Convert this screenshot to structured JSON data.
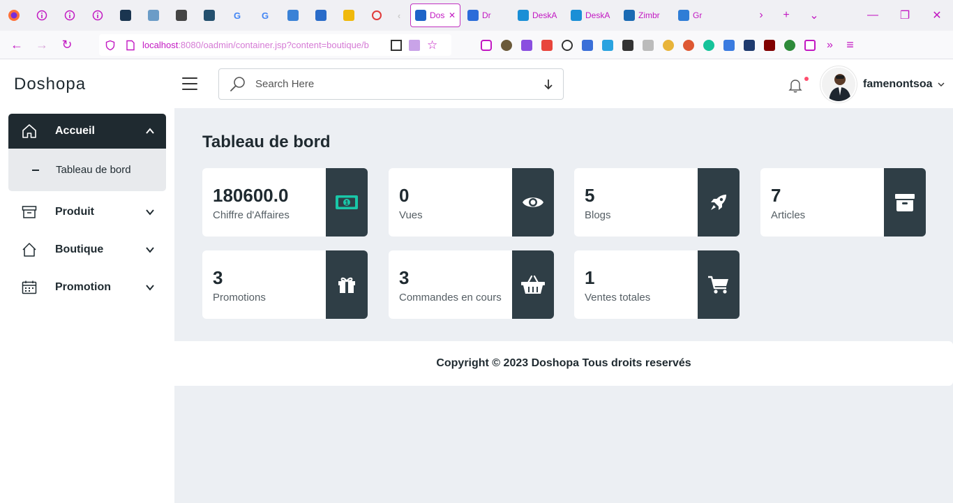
{
  "browser": {
    "active_tab_label": "Doshopa",
    "named_tabs": [
      {
        "label": "Dr",
        "color": "#2b6cd9"
      },
      {
        "label": "DeskA",
        "color": "#1a8fd6"
      },
      {
        "label": "DeskA",
        "color": "#1a8fd6"
      },
      {
        "label": "Zimbr",
        "color": "#1a6ab3"
      },
      {
        "label": "Gr",
        "color": "#2f7dd6"
      }
    ],
    "url_host": "localhost",
    "url_rest": ":8080/oadmin/container.jsp?content=boutique/b",
    "accent_color": "#c218c2"
  },
  "header": {
    "brand": "Doshopa",
    "search_placeholder": "Search Here",
    "username": "famenontsoa"
  },
  "sidebar": {
    "active": {
      "label": "Accueil",
      "subitem": "Tableau de bord"
    },
    "items": [
      {
        "label": "Produit",
        "icon": "archive-icon"
      },
      {
        "label": "Boutique",
        "icon": "house-icon"
      },
      {
        "label": "Promotion",
        "icon": "calendar-icon"
      }
    ]
  },
  "main": {
    "title": "Tableau de bord",
    "cards": [
      {
        "value": "180600.0",
        "label": "Chiffre d'Affaires",
        "icon": "money-icon",
        "icon_color": "#19c7a8"
      },
      {
        "value": "0",
        "label": "Vues",
        "icon": "eye-icon"
      },
      {
        "value": "5",
        "label": "Blogs",
        "icon": "rocket-icon"
      },
      {
        "value": "7",
        "label": "Articles",
        "icon": "archive-box-icon"
      },
      {
        "value": "3",
        "label": "Promotions",
        "icon": "gift-icon"
      },
      {
        "value": "3",
        "label": "Commandes en cours",
        "icon": "basket-icon"
      },
      {
        "value": "1",
        "label": "Ventes totales",
        "icon": "cart-icon"
      }
    ],
    "footer": "Copyright © 2023 Doshopa Tous droits reservés"
  }
}
